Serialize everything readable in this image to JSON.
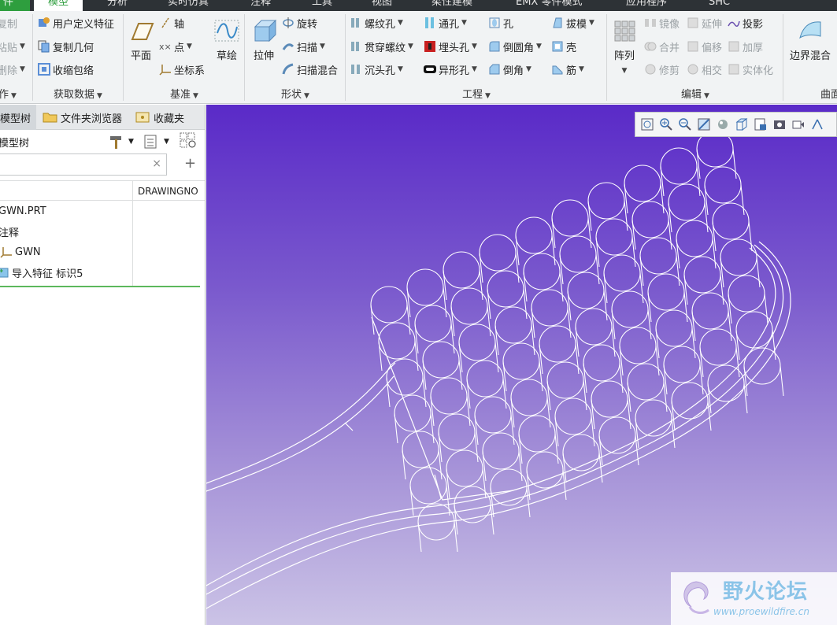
{
  "tabs": [
    "件",
    "模型",
    "分析",
    "实时仿真",
    "注释",
    "工具",
    "视图",
    "柔性建模",
    "EMX 零件模式",
    "应用程序",
    "SHC"
  ],
  "ribbon": {
    "operations": {
      "items": [
        "复制",
        "粘贴",
        "删除"
      ],
      "label": "作"
    },
    "get_data": {
      "items": [
        "用户定义特征",
        "复制几何",
        "收缩包络"
      ],
      "label": "获取数据"
    },
    "datum": {
      "plane": "平面",
      "axis": "轴",
      "point": "点",
      "csys": "坐标系",
      "sketch": "草绘",
      "label": "基准"
    },
    "shapes": {
      "extrude": "拉伸",
      "revolve": "旋转",
      "sweep": "扫描",
      "swept_blend": "扫描混合",
      "label": "形状"
    },
    "engineering": {
      "col1": [
        "螺纹孔",
        "贯穿螺纹",
        "沉头孔"
      ],
      "col2": [
        "通孔",
        "埋头孔",
        "异形孔"
      ],
      "col3": [
        "孔",
        "倒圆角",
        "倒角"
      ],
      "col4": [
        "拔模",
        "壳",
        "筋"
      ],
      "label": "工程"
    },
    "editing": {
      "pattern": "阵列",
      "col1": [
        "镜像",
        "合并",
        "修剪"
      ],
      "col2": [
        "延伸",
        "偏移",
        "相交"
      ],
      "col3": [
        "投影",
        "加厚",
        "实体化"
      ],
      "label": "编辑"
    },
    "surfaces": {
      "boundary_blend": "边界混合",
      "label": "曲面"
    }
  },
  "left_panel": {
    "nav_tabs": [
      "模型树",
      "文件夹浏览器",
      "收藏夹"
    ],
    "tree_title": "模型树",
    "column_header": "DRAWINGNO",
    "rows": [
      "GWN.PRT",
      "注释",
      "GWN",
      "导入特征 标识5"
    ],
    "search_clear": "×",
    "add": "+"
  },
  "watermark": {
    "title": "野火论坛",
    "url": "www.proewildfire.cn"
  },
  "colors": {
    "accent": "#2e9e3e",
    "viewport_top": "#5a2ac8",
    "viewport_bottom": "#cbc3e6"
  }
}
